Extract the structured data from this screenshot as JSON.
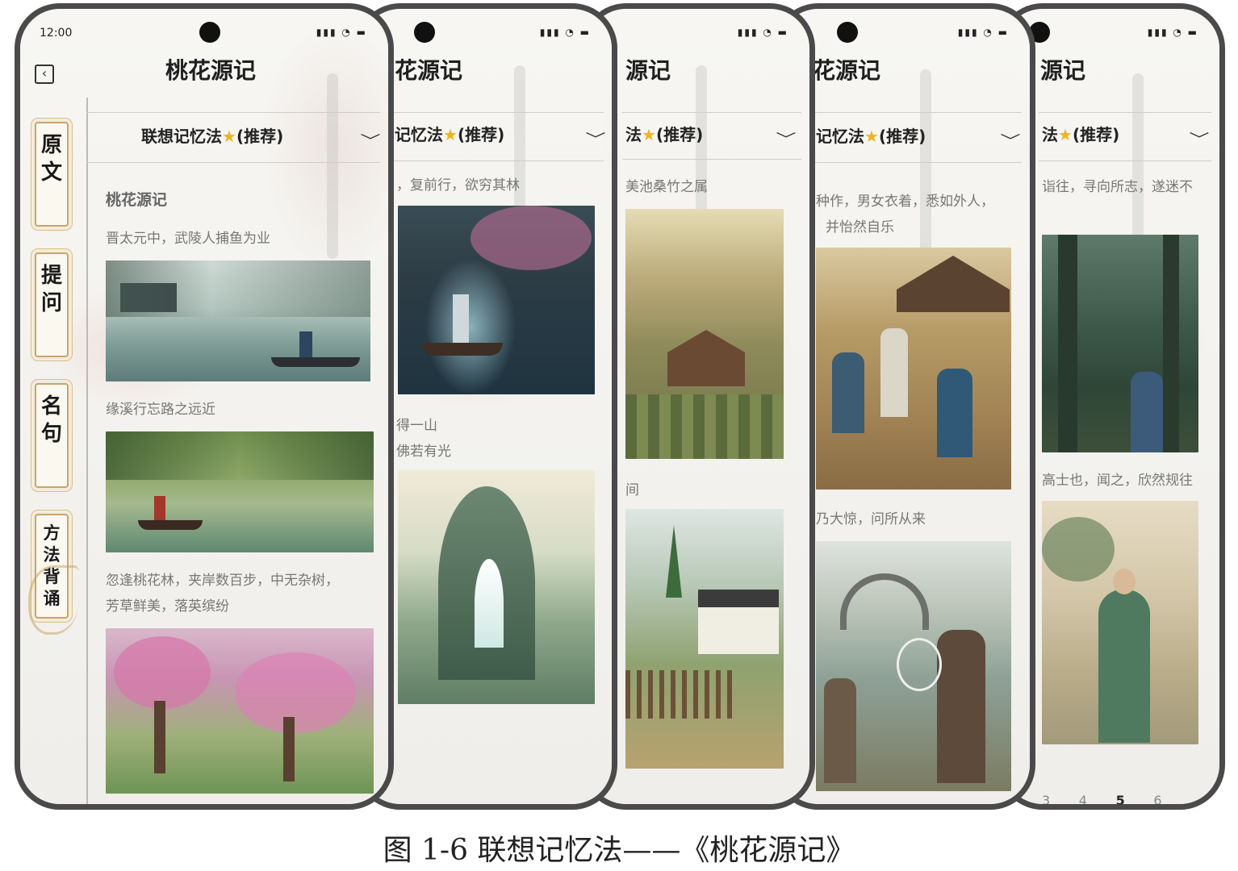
{
  "status": {
    "time": "12:00",
    "icons": "▮▮▮ ◔ ▬"
  },
  "app": {
    "title": "桃花源记",
    "title_crop_2": "花源记",
    "title_crop_3": "源记",
    "title_crop_4": "花源记",
    "title_crop_5": "源记",
    "back_icon": "chevron-left-icon"
  },
  "method_selector": {
    "full": "联想记忆法",
    "crop_2": "记忆法",
    "crop_3": "法",
    "crop_4": "记忆法",
    "crop_5": "法",
    "star": "★",
    "tag": "(推荐)",
    "chevron": "﹀"
  },
  "side_tabs": [
    "原文",
    "提问",
    "名句",
    "方法背诵"
  ],
  "screens": {
    "s1": {
      "heading": "桃花源记",
      "lines": [
        "晋太元中，武陵人捕鱼为业",
        "缘溪行忘路之远近",
        "忽逢桃花林，夹岸数百步，中无杂树，",
        "芳草鲜美，落英缤纷"
      ]
    },
    "s2": {
      "lines": [
        "，复前行，欲穷其林",
        "得一山",
        "佛若有光"
      ]
    },
    "s3": {
      "lines": [
        "美池桑竹之属",
        "间"
      ]
    },
    "s4": {
      "lines": [
        "种作，男女衣着，悉如外人，",
        "并怡然自乐",
        "乃大惊，问所从来"
      ]
    },
    "s5": {
      "lines": [
        "诣往，寻向所志，遂迷不",
        "高士也，闻之，欣然规往"
      ]
    }
  },
  "pager": {
    "pages": [
      "3",
      "4",
      "5",
      "6"
    ],
    "current": "5"
  },
  "caption": "图 1-6  联想记忆法——《桃花源记》"
}
